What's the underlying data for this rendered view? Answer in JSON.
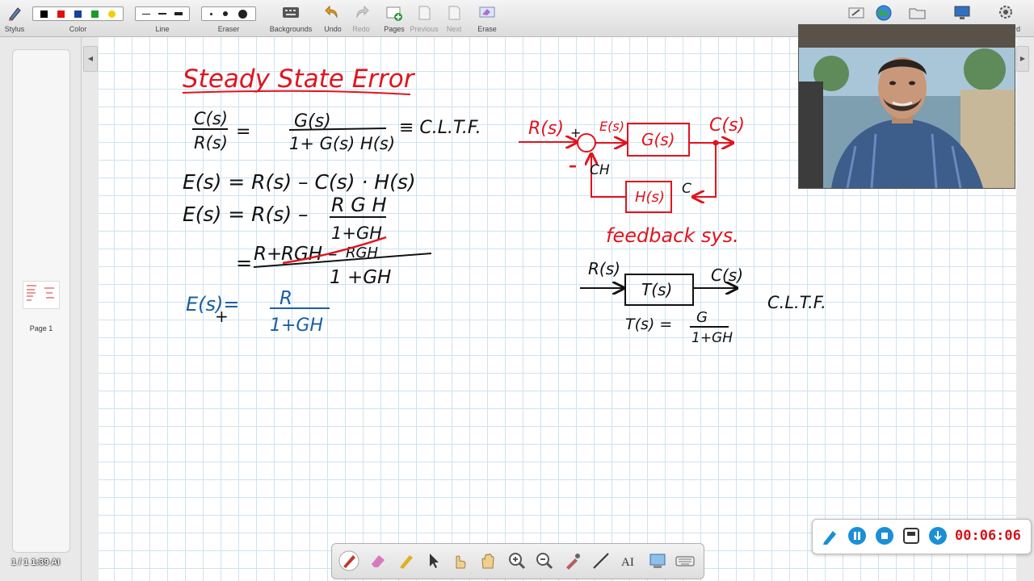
{
  "toolbar": {
    "stylus": "Stylus",
    "color": "Color",
    "line": "Line",
    "eraser": "Eraser",
    "backgrounds": "Backgrounds",
    "undo": "Undo",
    "redo": "Redo",
    "pages": "Pages",
    "previous": "Previous",
    "next": "Next",
    "erase": "Erase",
    "keyboard_partial": "ard",
    "swatches": [
      "#000000",
      "#e01010",
      "#1a3fa0",
      "#1a9a2a",
      "#f0d000"
    ]
  },
  "sidebar": {
    "thumb_label": "Page 1",
    "page_counter": "1 / 1 1:39 AI"
  },
  "board": {
    "title": "Steady State Error",
    "eq1_num": "C(s)",
    "eq1_den": "R(s)",
    "eq1_eq": "=",
    "eq1_rnum": "G(s)",
    "eq1_rden": "1+ G(s) H(s)",
    "eq1_tail": "≡ C.L.T.F.",
    "eq2": "E(s) = R(s) – C(s) · H(s)",
    "eq3_lhs": "E(s) = R(s) –",
    "eq3_num": "R G H",
    "eq3_den": "1+GH",
    "eq4_eq": "=",
    "eq4_num_a": "R+",
    "eq4_num_b": "RGH",
    "eq4_num_c": "–",
    "eq4_num_d": "RGH",
    "eq4_den": "1 +GH",
    "eq5_lhs": "E(s)=",
    "eq5_num": "R",
    "eq5_den": "1+GH",
    "eq5_mark": "+",
    "diag_rs": "R(s)",
    "diag_plus": "+",
    "diag_minus": "–",
    "diag_es": "E(s)",
    "diag_gs": "G(s)",
    "diag_cs": "C(s)",
    "diag_hs": "H(s)",
    "diag_ch": "CH",
    "diag_c": "C",
    "diag_caption": "feedback sys.",
    "blk_in": "R(s)",
    "blk_t": "T(s)",
    "blk_out": "C(s)",
    "blk_cltf": "C.L.T.F.",
    "blk_eq_lhs": "T(s) =",
    "blk_eq_num": "G",
    "blk_eq_den": "1+GH"
  },
  "recorder": {
    "time": "00:06:06"
  },
  "colors": {
    "red_ink": "#e0141e",
    "black_ink": "#111111",
    "blue_ink": "#1b5fa0",
    "timer": "#d2141b",
    "rec_button": "#1a8fd8"
  }
}
